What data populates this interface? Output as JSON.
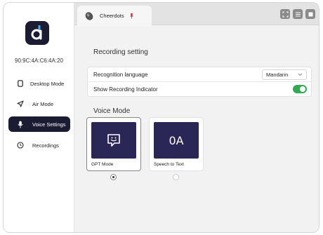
{
  "sidebar": {
    "device_id": "90:9C:4A:C6:4A:20",
    "items": [
      {
        "label": "Desktop Mode",
        "icon": "phone-icon"
      },
      {
        "label": "Air Mode",
        "icon": "send-arrow-icon"
      },
      {
        "label": "Voice Settings",
        "icon": "microphone-icon",
        "active": true
      },
      {
        "label": "Recordings",
        "icon": "clock-icon"
      }
    ]
  },
  "tabbar": {
    "tab_label": "Cheerdots",
    "window_buttons": [
      "fullscreen-icon",
      "menu-icon",
      "stop-icon"
    ]
  },
  "recording": {
    "section_title": "Recording setting",
    "language_label": "Recognition language",
    "language_value": "Mandarin",
    "indicator_label": "Show Recording Indicator",
    "indicator_on": true
  },
  "voice_mode": {
    "title": "Voice Mode",
    "modes": [
      {
        "label": "GPT Mode",
        "icon": "chat-smile-icon",
        "selected": true
      },
      {
        "label": "Speech to Text",
        "icon": "ocr-text-icon",
        "icon_text": "0A",
        "selected": false
      }
    ]
  },
  "colors": {
    "accent_dark": "#1b1c33",
    "card_bg": "#2a2656",
    "toggle_on": "#34a853"
  }
}
